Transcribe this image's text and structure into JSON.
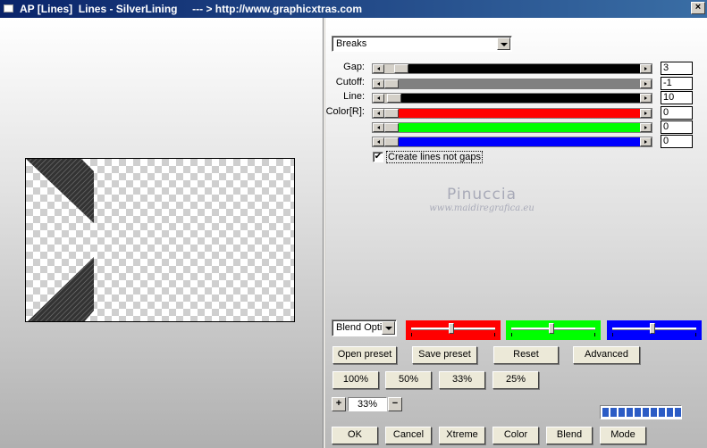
{
  "window": {
    "title": "AP [Lines]  Lines - SilverLining     --- > http://www.graphicxtras.com",
    "close_glyph": "×"
  },
  "mode_select": {
    "value": "Breaks"
  },
  "sliders": [
    {
      "id": "gap",
      "label": "Gap:",
      "value": "3",
      "level_pct": 4,
      "fill": "#000000"
    },
    {
      "id": "cutoff",
      "label": "Cutoff:",
      "value": "-1",
      "level_pct": 0,
      "fill": "#808080"
    },
    {
      "id": "line",
      "label": "Line:",
      "value": "10",
      "level_pct": 1,
      "fill": "#000000"
    },
    {
      "id": "color-r",
      "label": "Color[R]:",
      "value": "0",
      "level_pct": 0,
      "fill": "#ff0000"
    },
    {
      "id": "color-g",
      "label": "",
      "value": "0",
      "level_pct": 0,
      "fill": "#00ff00"
    },
    {
      "id": "color-b",
      "label": "",
      "value": "0",
      "level_pct": 0,
      "fill": "#0000ff"
    }
  ],
  "checkbox": {
    "label": "Create lines not gaps",
    "checked": true,
    "check_glyph": "✔"
  },
  "watermark": {
    "line1": "Pinuccia",
    "line2": "www.maidiregrafica.eu"
  },
  "blend_select": {
    "value": "Blend Optio"
  },
  "color_panels": [
    {
      "id": "red",
      "color": "#ff0000"
    },
    {
      "id": "green",
      "color": "#00ff00"
    },
    {
      "id": "blue",
      "color": "#0000ff"
    }
  ],
  "preset_buttons": {
    "open": "Open preset",
    "save": "Save preset",
    "reset": "Reset",
    "advanced": "Advanced"
  },
  "zoom_buttons": [
    "100%",
    "50%",
    "33%",
    "25%"
  ],
  "zoom": {
    "value": "33%",
    "plus": "+",
    "minus": "−"
  },
  "progress": {
    "segments": 10
  },
  "bottom_buttons": {
    "ok": "OK",
    "cancel": "Cancel",
    "xtreme": "Xtreme",
    "color": "Color",
    "blend": "Blend",
    "mode": "Mode"
  }
}
